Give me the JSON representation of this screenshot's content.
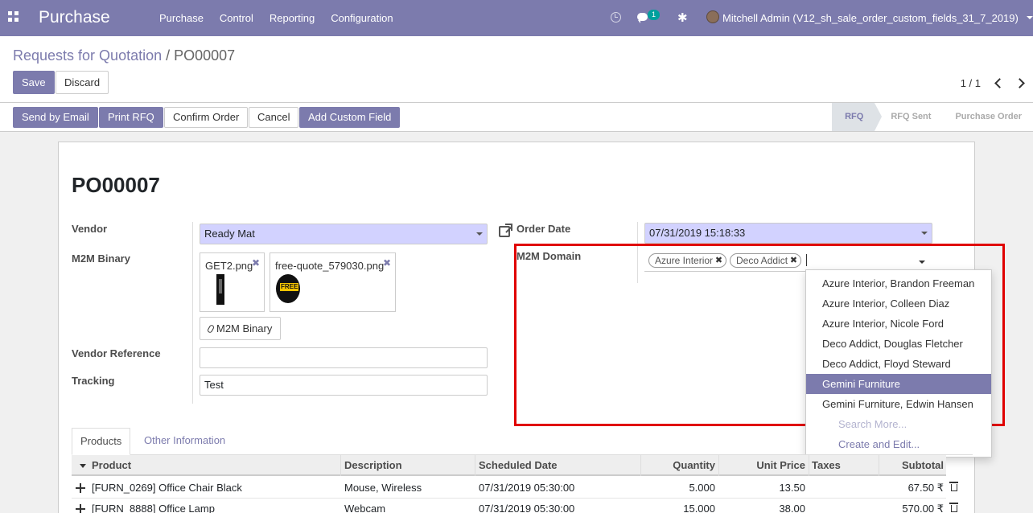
{
  "navbar": {
    "brand": "Purchase",
    "menu": [
      "Purchase",
      "Control",
      "Reporting",
      "Configuration"
    ],
    "chat_count": "1",
    "user": "Mitchell Admin (V12_sh_sale_order_custom_fields_31_7_2019)"
  },
  "breadcrumb": {
    "parent": "Requests for Quotation",
    "separator": "/",
    "current": "PO00007"
  },
  "toolbar": {
    "save": "Save",
    "discard": "Discard",
    "pager": "1 / 1"
  },
  "actions": {
    "send_email": "Send by Email",
    "print_rfq": "Print RFQ",
    "confirm": "Confirm Order",
    "cancel": "Cancel",
    "add_custom": "Add Custom Field"
  },
  "stages": [
    "RFQ",
    "RFQ Sent",
    "Purchase Order"
  ],
  "form": {
    "title": "PO00007",
    "vendor_label": "Vendor",
    "vendor_value": "Ready Mat",
    "m2m_binary_label": "M2M Binary",
    "attachments": [
      {
        "name": "GET2.png"
      },
      {
        "name": "free-quote_579030.png"
      }
    ],
    "m2m_binary_button": "M2M Binary",
    "vendor_ref_label": "Vendor Reference",
    "vendor_ref_value": "",
    "tracking_label": "Tracking",
    "tracking_value": "Test",
    "order_date_label": "Order Date",
    "order_date_value": "07/31/2019 15:18:33",
    "m2m_domain_label": "M2M Domain",
    "tags": [
      "Azure Interior",
      "Deco Addict"
    ]
  },
  "dropdown": {
    "items": [
      "Azure Interior, Brandon Freeman",
      "Azure Interior, Colleen Diaz",
      "Azure Interior, Nicole Ford",
      "Deco Addict, Douglas Fletcher",
      "Deco Addict, Floyd Steward",
      "Gemini Furniture",
      "Gemini Furniture, Edwin Hansen"
    ],
    "selected_index": 5,
    "search_more": "Search More...",
    "create_edit": "Create and Edit..."
  },
  "tabs": [
    "Products",
    "Other Information"
  ],
  "grid": {
    "columns": [
      "Product",
      "Description",
      "Scheduled Date",
      "Quantity",
      "Unit Price",
      "Taxes",
      "Subtotal"
    ],
    "rows": [
      {
        "product": "[FURN_0269] Office Chair Black",
        "description": "Mouse, Wireless",
        "date": "07/31/2019 05:30:00",
        "qty": "5.000",
        "price": "13.50",
        "taxes": "",
        "subtotal": "67.50 ₹"
      },
      {
        "product": "[FURN_8888] Office Lamp",
        "description": "Webcam",
        "date": "07/31/2019 05:30:00",
        "qty": "15.000",
        "price": "38.00",
        "taxes": "",
        "subtotal": "570.00 ₹"
      }
    ]
  }
}
